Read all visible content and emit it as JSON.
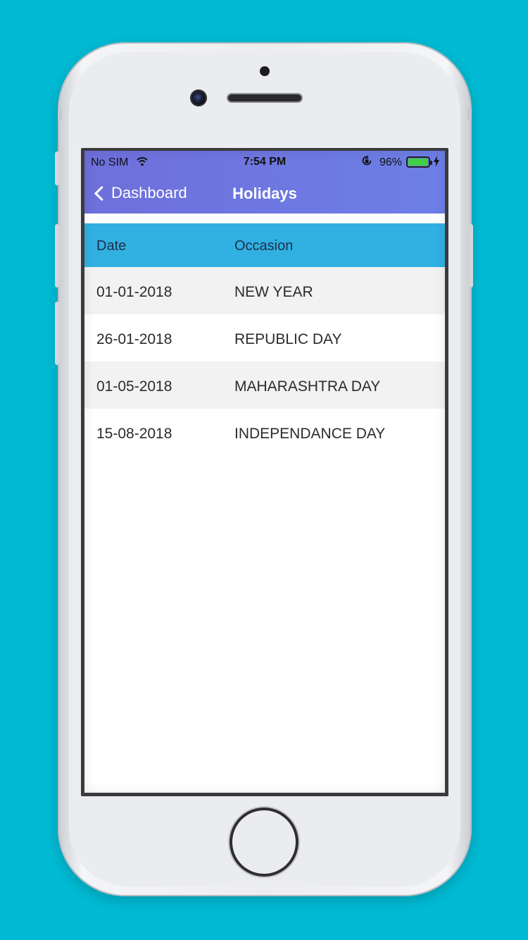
{
  "status_bar": {
    "carrier": "No SIM",
    "time": "7:54 PM",
    "battery_percent": "96%",
    "battery_level": 0.96,
    "icons": [
      "wifi-icon",
      "orientation-lock-icon",
      "battery-icon",
      "charging-bolt-icon"
    ]
  },
  "nav": {
    "back_label": "Dashboard",
    "title": "Holidays"
  },
  "table": {
    "headers": [
      "Date",
      "Occasion"
    ],
    "rows": [
      {
        "date": "01-01-2018",
        "occasion": "NEW YEAR"
      },
      {
        "date": "26-01-2018",
        "occasion": "REPUBLIC DAY"
      },
      {
        "date": "01-05-2018",
        "occasion": "MAHARASHTRA DAY"
      },
      {
        "date": "15-08-2018",
        "occasion": "INDEPENDANCE DAY"
      }
    ]
  },
  "colors": {
    "background": "#00BAD3",
    "nav_bar": "#6E78E0",
    "table_header": "#31B0E2",
    "row_alt": "#F2F2F2"
  }
}
